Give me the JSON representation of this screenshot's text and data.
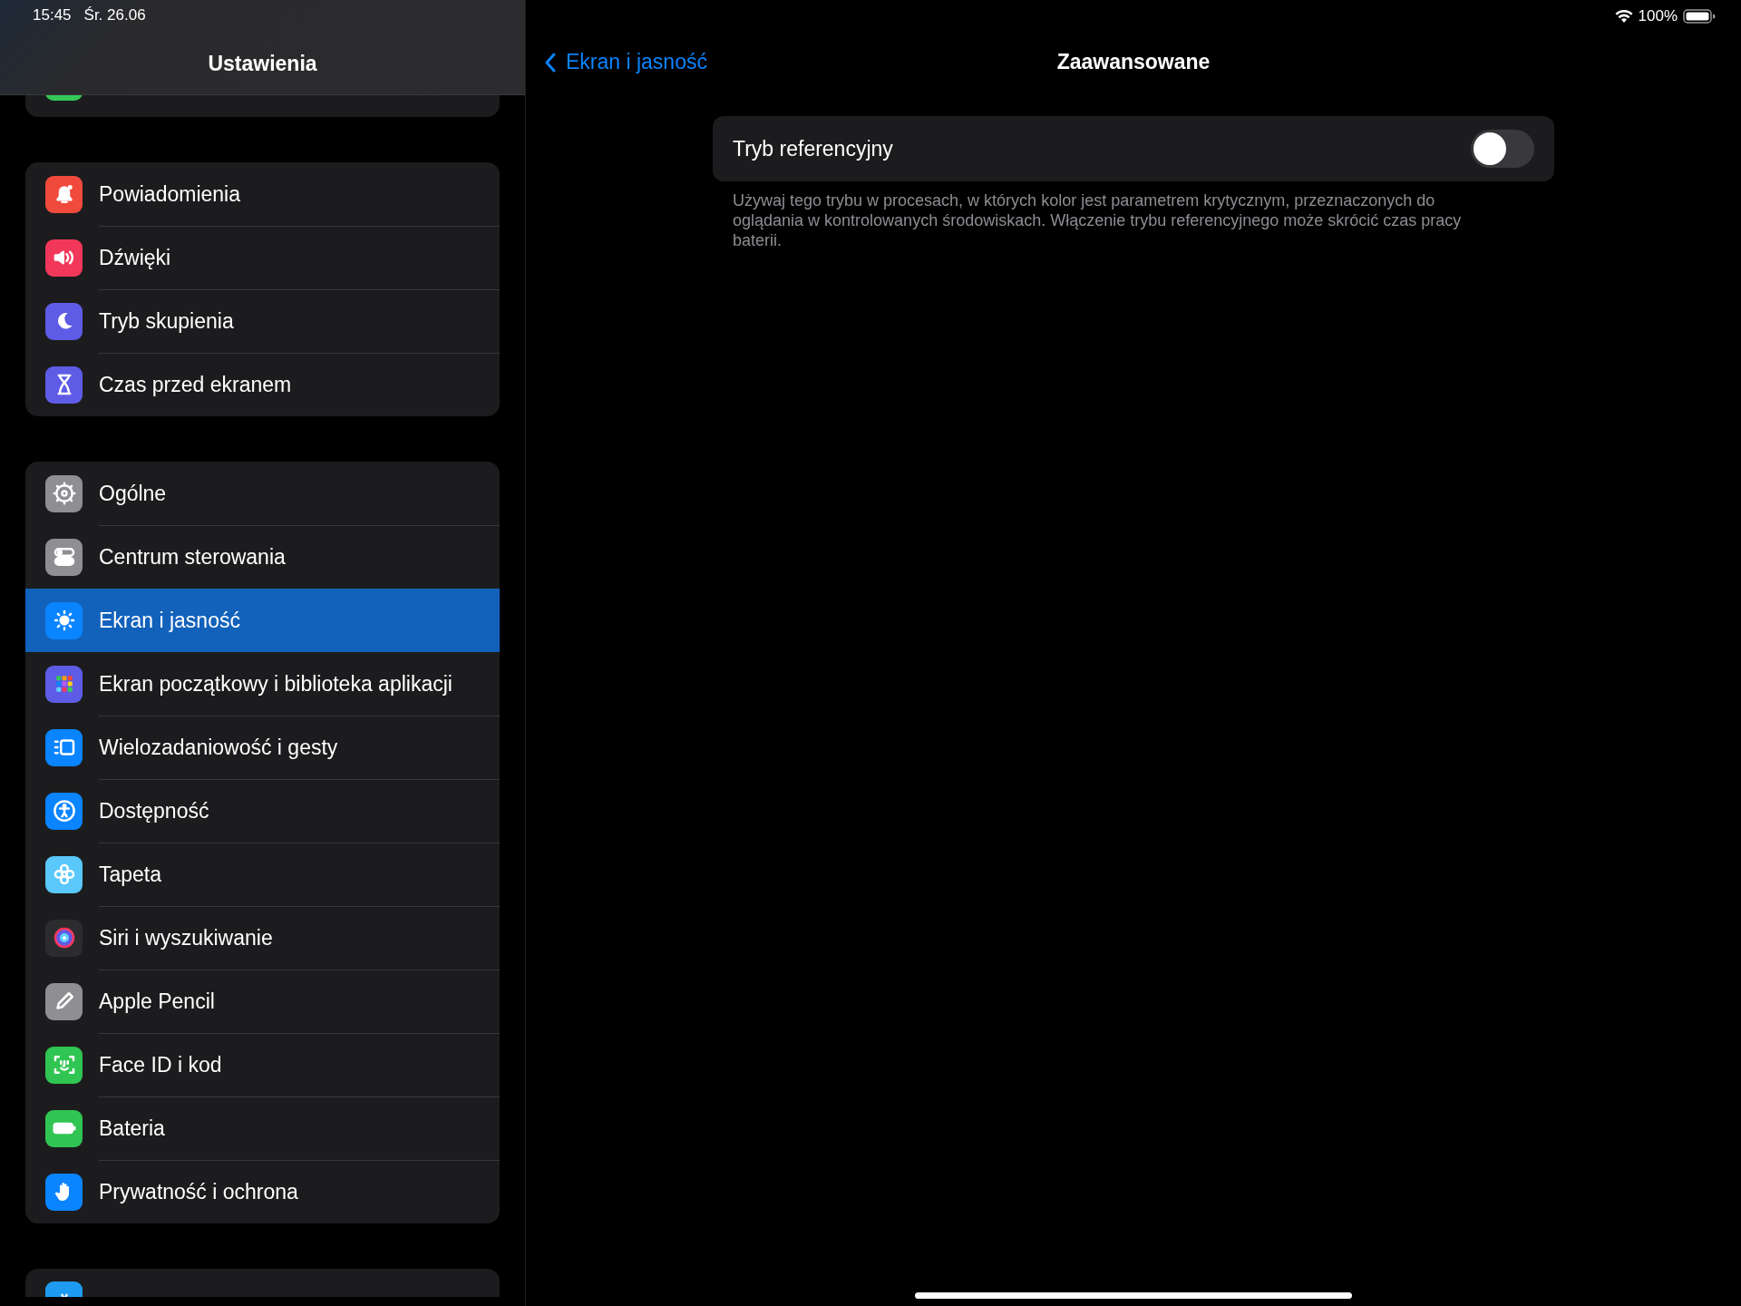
{
  "status_bar": {
    "time": "15:45",
    "date": "Śr. 26.06",
    "battery": "100%"
  },
  "sidebar": {
    "title": "Ustawienia",
    "groups": [
      {
        "items": [
          {
            "kind": "generic",
            "color": "#34c759",
            "selected": false
          }
        ]
      },
      {
        "items": [
          {
            "label": "Powiadomienia",
            "kind": "bell",
            "color": "#f04a3d",
            "selected": false
          },
          {
            "label": "Dźwięki",
            "kind": "speaker",
            "color": "#f2385a",
            "selected": false
          },
          {
            "label": "Tryb skupienia",
            "kind": "moon",
            "color": "#5e5ce6",
            "selected": false
          },
          {
            "label": "Czas przed ekranem",
            "kind": "hourglass",
            "color": "#5e5ce6",
            "selected": false
          }
        ]
      },
      {
        "items": [
          {
            "label": "Ogólne",
            "kind": "gear",
            "color": "#8e8e93",
            "selected": false
          },
          {
            "label": "Centrum sterowania",
            "kind": "toggles",
            "color": "#8e8e93",
            "selected": false
          },
          {
            "label": "Ekran i jasność",
            "kind": "sun",
            "color": "#0a84ff",
            "selected": true
          },
          {
            "label": "Ekran początkowy i biblioteka aplikacji",
            "kind": "grid",
            "color": "#5e5ce6",
            "selected": false
          },
          {
            "label": "Wielozadaniowość i gesty",
            "kind": "multitask",
            "color": "#0a84ff",
            "selected": false
          },
          {
            "label": "Dostępność",
            "kind": "accessibility",
            "color": "#0a84ff",
            "selected": false
          },
          {
            "label": "Tapeta",
            "kind": "flower",
            "color": "#5ac8fa",
            "selected": false
          },
          {
            "label": "Siri i wyszukiwanie",
            "kind": "siri",
            "color": "#2c2c2e",
            "selected": false
          },
          {
            "label": "Apple Pencil",
            "kind": "pencil",
            "color": "#8e8e93",
            "selected": false
          },
          {
            "label": "Face ID i kod",
            "kind": "faceid",
            "color": "#30c552",
            "selected": false
          },
          {
            "label": "Bateria",
            "kind": "battery",
            "color": "#30c552",
            "selected": false
          },
          {
            "label": "Prywatność i ochrona",
            "kind": "hand",
            "color": "#0a84ff",
            "selected": false
          }
        ]
      },
      {
        "items": [
          {
            "kind": "appstore",
            "color": "#1e9bf0",
            "selected": false
          }
        ]
      }
    ]
  },
  "detail": {
    "back": "Ekran i jasność",
    "title": "Zaawansowane",
    "settings": [
      {
        "label": "Tryb referencyjny",
        "on": false
      }
    ],
    "footer": "Używaj tego trybu w procesach, w których kolor jest parametrem krytycznym, przeznaczonych do oglądania w kontrolowanych środowiskach. Włączenie trybu referencyjnego może skrócić czas pracy baterii."
  }
}
